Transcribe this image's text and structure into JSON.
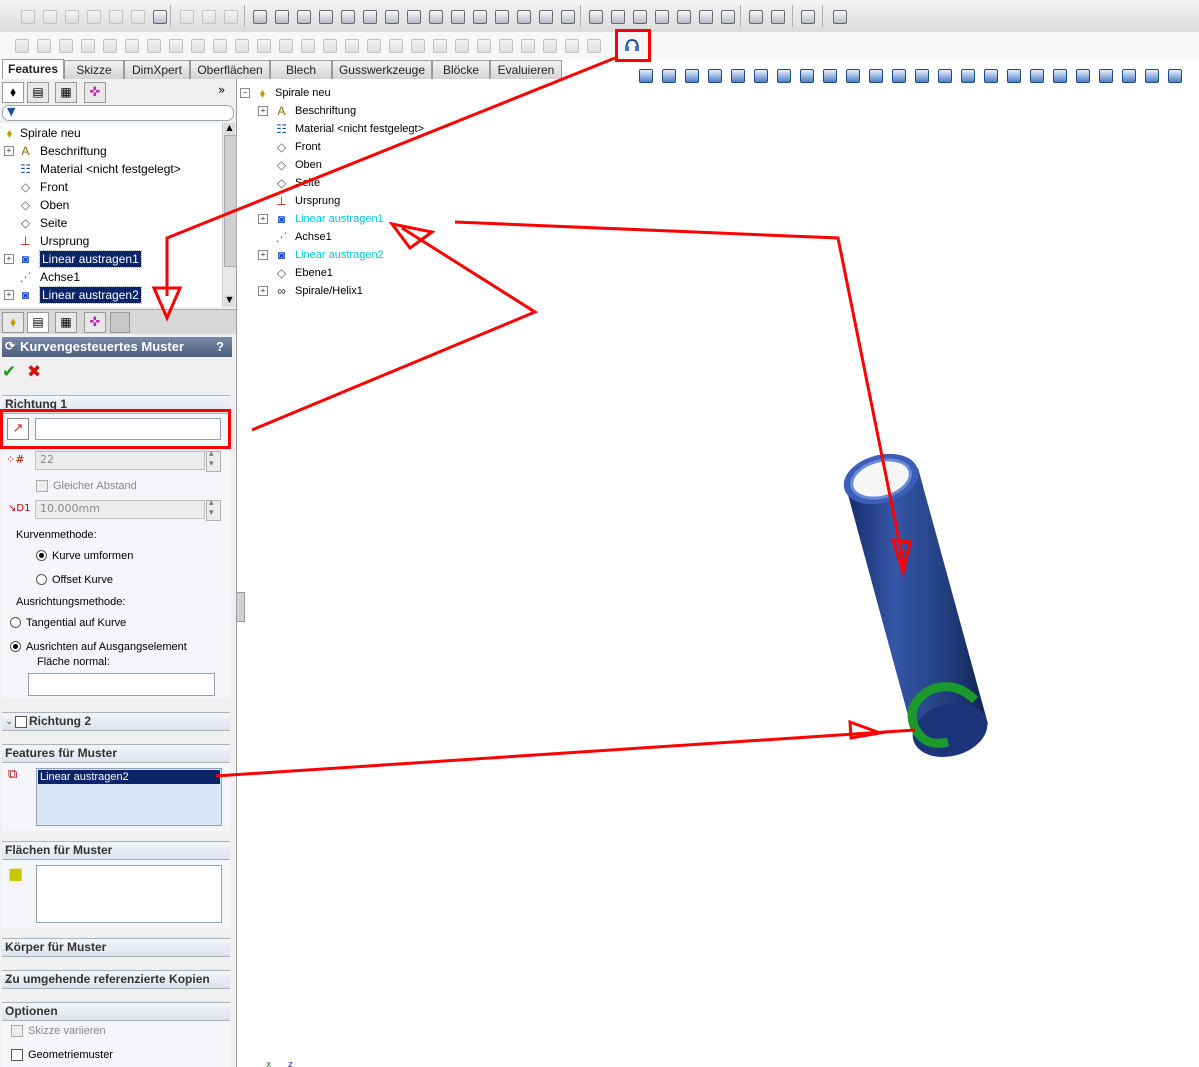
{
  "tabs": [
    "Features",
    "Skizze",
    "DimXpert",
    "Oberflächen",
    "Blech",
    "Gusswerkzeuge",
    "Blöcke",
    "Evaluieren"
  ],
  "feature_tree": {
    "root": "Spirale neu",
    "items": [
      {
        "label": "Beschriftung",
        "icon": "annotation-icon"
      },
      {
        "label": "Material <nicht festgelegt>",
        "icon": "material-icon"
      },
      {
        "label": "Front",
        "icon": "plane-icon"
      },
      {
        "label": "Oben",
        "icon": "plane-icon"
      },
      {
        "label": "Seite",
        "icon": "plane-icon"
      },
      {
        "label": "Ursprung",
        "icon": "origin-icon"
      },
      {
        "label": "Linear austragen1",
        "icon": "extrude-icon"
      },
      {
        "label": "Achse1",
        "icon": "axis-icon"
      },
      {
        "label": "Linear austragen2",
        "icon": "extrude-icon"
      }
    ]
  },
  "graphics_tree": {
    "root": "Spirale neu",
    "items": [
      {
        "label": "Beschriftung"
      },
      {
        "label": "Material <nicht festgelegt>"
      },
      {
        "label": "Front"
      },
      {
        "label": "Oben"
      },
      {
        "label": "Seite"
      },
      {
        "label": "Ursprung"
      },
      {
        "label": "Linear austragen1"
      },
      {
        "label": "Achse1"
      },
      {
        "label": "Linear austragen2"
      },
      {
        "label": "Ebene1"
      },
      {
        "label": "Spirale/Helix1"
      }
    ]
  },
  "property_manager": {
    "title": "Kurvengesteuertes Muster",
    "help": "?",
    "richtung1": {
      "header": "Richtung 1",
      "instances": "22",
      "equal_spacing": "Gleicher Abstand",
      "spacing": "10.000mm",
      "curve_method_label": "Kurvenmethode:",
      "curve_method_options": [
        "Kurve umformen",
        "Offset Kurve"
      ],
      "align_method_label": "Ausrichtungsmethode:",
      "align_options": [
        "Tangential auf Kurve",
        "Ausrichten auf Ausgangselement"
      ],
      "face_normal_label": "Fläche normal:"
    },
    "richtung2": "Richtung 2",
    "features_header": "Features für Muster",
    "features_item": "Linear austragen2",
    "faces_header": "Flächen für Muster",
    "bodies_header": "Körper für Muster",
    "skip_header": "Zu umgehende referenzierte Kopien",
    "options_header": "Optionen",
    "options": [
      "Skizze variieren",
      "Geometriemuster"
    ]
  }
}
